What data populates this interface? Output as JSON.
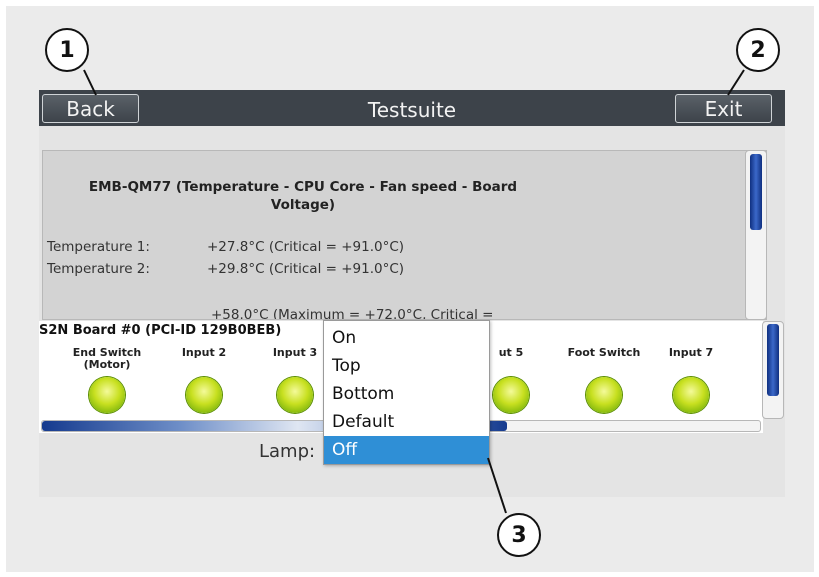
{
  "callouts": [
    "1",
    "2",
    "3"
  ],
  "titlebar": {
    "back_label": "Back",
    "title": "Testsuite",
    "exit_label": "Exit"
  },
  "panel": {
    "heading": "EMB-QM77 (Temperature - CPU Core - Fan speed - Board Voltage)",
    "rows": [
      {
        "label": "Temperature 1:",
        "value": "+27.8°C (Critical = +91.0°C)"
      },
      {
        "label": "Temperature 2:",
        "value": "+29.8°C (Critical = +91.0°C)"
      }
    ],
    "cutoff_line": "+58.0°C (Maximum = +72.0°C, Critical ="
  },
  "board": {
    "title": "S2N Board #0 (PCI-ID 129B0BEB)",
    "indicators": [
      {
        "label": "End Switch (Motor)",
        "state": "on"
      },
      {
        "label": "Input 2",
        "state": "on"
      },
      {
        "label": "Input 3",
        "state": "on"
      },
      {
        "label": "ut 5",
        "state": "on"
      },
      {
        "label": "Foot Switch",
        "state": "on"
      },
      {
        "label": "Input 7",
        "state": "on"
      }
    ],
    "lamp_color": "#c8e020"
  },
  "lamp": {
    "label": "Lamp:",
    "options": [
      "On",
      "Top",
      "Bottom",
      "Default",
      "Off"
    ],
    "selected": "Off"
  },
  "colors": {
    "titlebar": "#3d434a",
    "selection": "#2f8fd6",
    "scroll_thumb": "#1b3f9a"
  }
}
